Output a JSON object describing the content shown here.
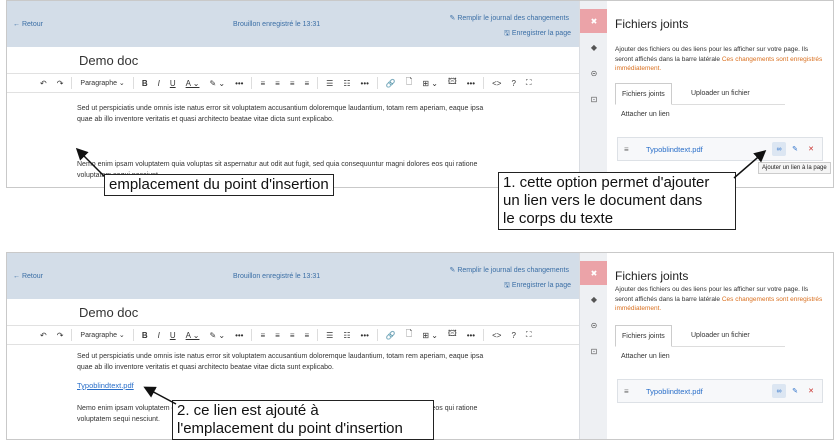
{
  "editor": {
    "back": "← Retour",
    "saved": "Brouillon enregistré le 13:31",
    "changelog": "Remplir le journal des changements",
    "save_page": "Enregistrer la page",
    "doc_title": "Demo doc",
    "toolbar": {
      "undo": "↶",
      "redo": "↷",
      "paragraph": "Paragraphe ⌄",
      "bold": "B",
      "italic": "I",
      "underline": "U",
      "font_color": "A ⌄",
      "highlight": "✎ ⌄",
      "more1": "•••",
      "align_left": "≡",
      "align_center": "≡",
      "align_right": "≡",
      "justify": "≡",
      "bullets": "☰",
      "numbers": "☷",
      "more2": "•••",
      "link": "🔗",
      "file": "🗋",
      "table": "⊞ ⌄",
      "image": "🖾",
      "more3": "•••",
      "code": "<>",
      "help": "?",
      "fullscreen": "⛶"
    },
    "para1": "Sed ut perspiciatis unde omnis iste natus error sit voluptatem accusantium doloremque laudantium, totam rem aperiam, eaque ipsa quae ab illo inventore veritatis et quasi architecto beatae vitae dicta sunt explicabo.",
    "para2_p1": "Nemo enim ipsam voluptatem quia voluptas sit aspernatur aut odit aut fugit, sed quia consequuntur magni dolores eos qui ratione voluptatem sequi nesciunt.",
    "para2_p2": "Nemo enim ipsam voluptatem quia voluptas sit aspernatur aut odit aut fugit, sed quia consequuntur magni dolores eos qui ratione voluptatem sequi nesciunt.",
    "inserted_link": "Typoblindtext.pdf"
  },
  "rail": {
    "close": "✖",
    "tag": "◆",
    "link": "⊝",
    "box": "⊡"
  },
  "attachments": {
    "title": "Fichiers joints",
    "desc": "Ajouter des fichiers ou des liens pour les afficher sur votre page. Ils seront affichés dans la barre latérale",
    "warning": "Ces changements sont enregistrés immédiatement.",
    "tabs": [
      "Fichiers joints",
      "Uploader un fichier"
    ],
    "tab3": "Attacher un lien",
    "file_handle": "≡",
    "file_name": "Typoblindtext.pdf",
    "btn_link": "∞",
    "btn_edit": "✎",
    "btn_delete": "✕",
    "tooltip": "Ajouter un lien à la page"
  },
  "callouts": {
    "c1": "emplacement du point d'insertion",
    "c2_l1": "1. cette option permet d'ajouter",
    "c2_l2": "un lien vers le document dans",
    "c2_l3": "le corps du texte",
    "c3_l1": "2. ce lien est ajouté à",
    "c3_l2": "l'emplacement du point d'insertion"
  }
}
